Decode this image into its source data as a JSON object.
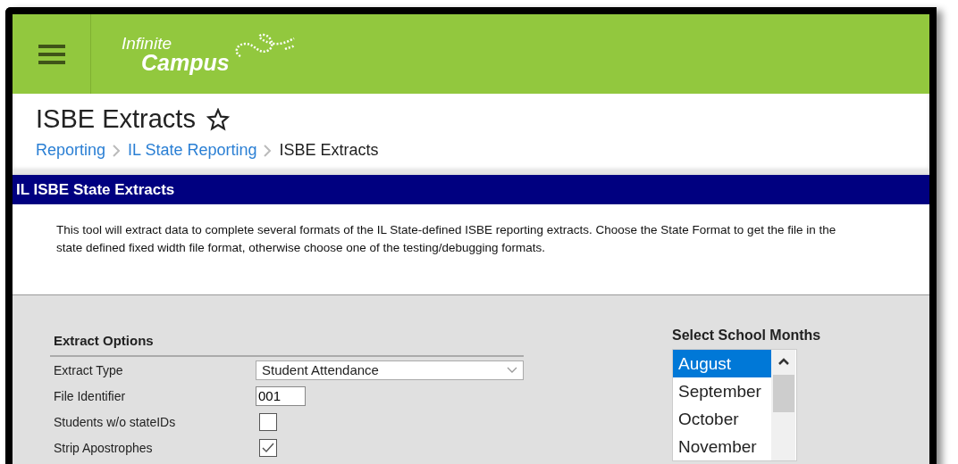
{
  "header": {
    "logo_line_1": "Infinite",
    "logo_line_2": "Campus"
  },
  "page": {
    "title": "ISBE Extracts",
    "favorite": false,
    "breadcrumbs": [
      {
        "label": "Reporting",
        "link": true
      },
      {
        "label": "IL State Reporting",
        "link": true
      },
      {
        "label": "ISBE Extracts",
        "link": false
      }
    ]
  },
  "panel": {
    "title": "IL ISBE State Extracts",
    "description": "This tool will extract data to complete several formats of the IL State-defined ISBE reporting extracts. Choose the State Format to get the file in the state defined fixed width file format, otherwise choose one of the testing/debugging formats."
  },
  "extract_options": {
    "heading": "Extract Options",
    "fields": [
      {
        "kind": "select",
        "label": "Extract Type",
        "value": "Student Attendance"
      },
      {
        "kind": "text",
        "label": "File Identifier",
        "value": "001"
      },
      {
        "kind": "checkbox",
        "label": "Students w/o stateIDs",
        "checked": false
      },
      {
        "kind": "checkbox",
        "label": "Strip Apostrophes",
        "checked": true
      }
    ]
  },
  "school_months": {
    "heading": "Select School Months",
    "months": [
      {
        "label": "August",
        "selected": true
      },
      {
        "label": "September",
        "selected": false
      },
      {
        "label": "October",
        "selected": false
      },
      {
        "label": "November",
        "selected": false
      }
    ]
  }
}
